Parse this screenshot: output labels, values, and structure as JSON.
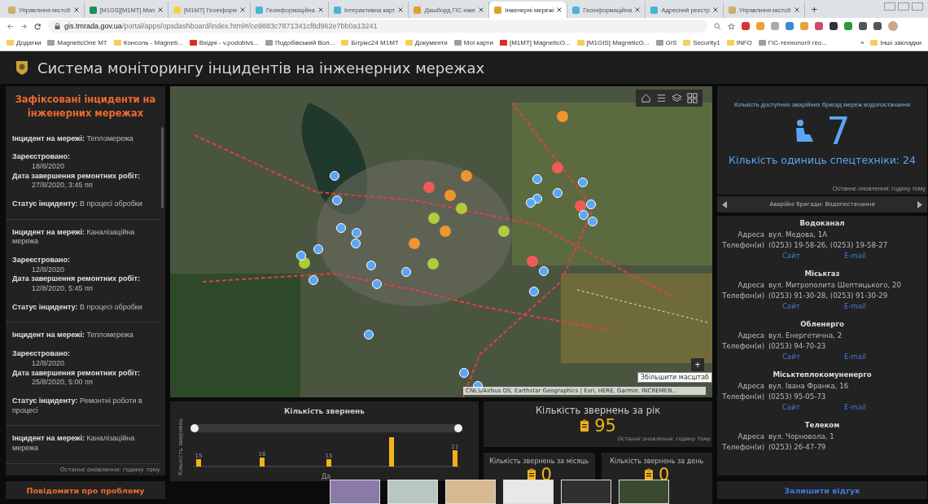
{
  "browser": {
    "tabs": [
      {
        "label": "Управління містоб",
        "selected": false
      },
      {
        "label": "[M1GS][M1MT] Мап",
        "selected": false
      },
      {
        "label": "[M1MT] Геоінформ",
        "selected": false
      },
      {
        "label": "Геоінформаційна",
        "selected": false
      },
      {
        "label": "Інтерактивна карт",
        "selected": false
      },
      {
        "label": "Дашборд ГІС інже",
        "selected": false
      },
      {
        "label": "Інженерні мережі",
        "selected": true
      },
      {
        "label": "Геоінформаційна",
        "selected": false
      },
      {
        "label": "Адресний реєстр",
        "selected": false
      },
      {
        "label": "Управління містоб",
        "selected": false
      }
    ],
    "new_tab": "+",
    "url_host": "gis.tmrada.gov.ua",
    "url_path": "/portal/apps/opsdashboard/index.html#/ce9883c7871341cf8d962e7bb0a13241",
    "bookmarks": [
      "Додатки",
      "MagneticOne MT",
      "Консоль - Magneti...",
      "Вхідні - v.podobivs...",
      "Подобівський Вол...",
      "Бітрікс24 M1MT",
      "Документи",
      "Мої карти",
      "[M1MT] MagneticO...",
      "[M1GIS] MagneticO...",
      "GIS",
      "Security1",
      "INFO",
      "ГІС-технології гео..."
    ],
    "more": "»",
    "other_bookmarks": "Інші закладки"
  },
  "header": {
    "title": "Система моніторингу інцидентів на інженерних мережах"
  },
  "incidents": {
    "title": "Зафіксовані інциденти на інженерних мережах",
    "items": [
      {
        "network_label": "Інцидент на мережі:",
        "network": "Тепломережа",
        "registered_label": "Зареєстровано:",
        "registered": "18/8/2020",
        "completion_label": "Дата завершення ремонтних робіт:",
        "completion": "27/8/2020, 3:45 пп",
        "status_label": "Статус інциденту:",
        "status": "В процесі обробки"
      },
      {
        "network_label": "Інцидент на мережі:",
        "network": "Каналізаційна мережа",
        "registered_label": "Зареєстровано:",
        "registered": "12/8/2020",
        "completion_label": "Дата завершення ремонтних робіт:",
        "completion": "12/8/2020, 5:45 пп",
        "status_label": "Статус інциденту:",
        "status": "В процесі обробки"
      },
      {
        "network_label": "Інцидент на мережі:",
        "network": "Тепломережа",
        "registered_label": "Зареєстровано:",
        "registered": "12/8/2020",
        "completion_label": "Дата завершення ремонтних робіт:",
        "completion": "25/8/2020, 5:00 пп",
        "status_label": "Статус інциденту:",
        "status": "Ремонтні роботи в процесі"
      },
      {
        "network_label": "Інцидент на мережі:",
        "network": "Каналізаційна мережа"
      }
    ],
    "updated": "Останнє оновлення: годину тому",
    "button": "Повідомити про проблему"
  },
  "map": {
    "tooltip": "Збільшити масштаб",
    "zoom_in": "+",
    "attribution": "CNES/Airbus DS, Earthstar Geographics | Esri, HERE, Garmin, INCREMEN..."
  },
  "requests_chart": {
    "title": "Кількість звернень",
    "ylabel": "Кількість звернень",
    "xlabel": "Да",
    "range_slider": [
      {
        "level": 0
      },
      {
        "level": 1
      }
    ],
    "bars": [
      {
        "kind": "labeled",
        "label": "15"
      },
      {
        "kind": "labeled",
        "label": "16"
      },
      {
        "kind": "labeled",
        "label": "15"
      },
      {
        "kind": "plain"
      },
      {
        "kind": "labeled",
        "label": "21"
      }
    ]
  },
  "year_kpi": {
    "title": "Кількість звернень за рік",
    "value": "95",
    "updated": "Останнє оновлення: годину тому"
  },
  "month_kpi": {
    "title": "Кількість звернень за місяць",
    "value": "0"
  },
  "day_kpi": {
    "title": "Кількість звернень за день",
    "value": "0"
  },
  "brigades": {
    "title": "Кількість доступних аварійних бригад мереж водопостачання",
    "value": "7",
    "equipment": "Кількість одиниць спецтехніки: 24",
    "updated": "Останнє оновлення: годину тому",
    "nav_label": "Аварійні бригади: Водопостачання"
  },
  "contacts": [
    {
      "name": "Водоканал",
      "address_label": "Адреса",
      "address": "вул. Медова, 1А",
      "phone_label": "Телефон(и)",
      "phone": "(0253) 19-58-26, (0253) 19-58-27",
      "site": "Сайт",
      "email": "E-mail"
    },
    {
      "name": "Міськгаз",
      "address_label": "Адреса",
      "address": "вул. Митрополита Шептицького, 20",
      "phone_label": "Телефон(и)",
      "phone": "(0253) 91-30-28, (0253) 91-30-29",
      "site": "Сайт",
      "email": "E-mail"
    },
    {
      "name": "Обленерго",
      "address_label": "Адреса",
      "address": "вул. Енергетична, 2",
      "phone_label": "Телефон(и)",
      "phone": "(0253) 94-70-23",
      "site": "Сайт",
      "email": "E-mail"
    },
    {
      "name": "Міськтеплокомуненерго",
      "address_label": "Адреса",
      "address": "вул. Івана Франка, 16",
      "phone_label": "Телефон(и)",
      "phone": "(0253) 95-05-73",
      "site": "Сайт",
      "email": "E-mail"
    },
    {
      "name": "Телеком",
      "address_label": "Адреса",
      "address": "вул. Чорновола, 1",
      "phone_label": "Телефон(и)",
      "phone": "(0253) 26-47-79"
    }
  ],
  "feedback_button": "Залишити відгук"
}
